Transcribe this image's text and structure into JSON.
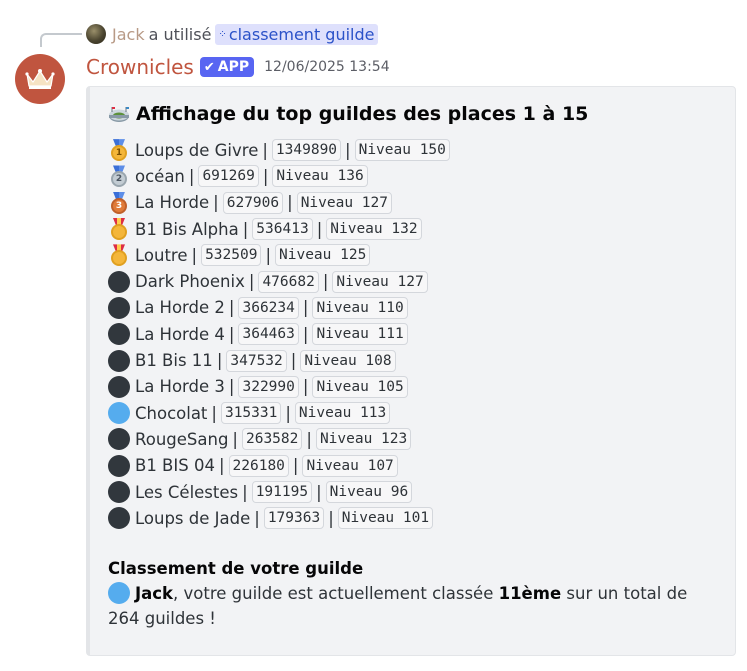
{
  "interaction": {
    "user": "Jack",
    "text": "a utilisé",
    "command_icon": "command-dots-icon",
    "command": "classement guilde"
  },
  "author": {
    "name": "Crownicles",
    "badge": "APP",
    "badge_icon": "check-icon",
    "timestamp": "12/06/2025 13:54",
    "avatar_icon": "crown-icon"
  },
  "embed": {
    "title_icon": "stadium-icon",
    "title": "Affichage du top guildes des places 1 à 15",
    "rows": [
      {
        "icon": "gold-medal",
        "rank": "1",
        "name": "Loups de Givre",
        "score": "1349890",
        "level": "Niveau 150"
      },
      {
        "icon": "silver-medal",
        "rank": "2",
        "name": "océan",
        "score": "691269",
        "level": "Niveau 136"
      },
      {
        "icon": "bronze-medal",
        "rank": "3",
        "name": "La Horde",
        "score": "627906",
        "level": "Niveau 127"
      },
      {
        "icon": "military-medal",
        "rank": "",
        "name": "B1 Bis Alpha",
        "score": "536413",
        "level": "Niveau 132"
      },
      {
        "icon": "military-medal",
        "rank": "",
        "name": "Loutre",
        "score": "532509",
        "level": "Niveau 125"
      },
      {
        "icon": "black-circle",
        "rank": "",
        "name": "Dark Phoenix",
        "score": "476682",
        "level": "Niveau 127"
      },
      {
        "icon": "black-circle",
        "rank": "",
        "name": "La Horde 2",
        "score": "366234",
        "level": "Niveau 110"
      },
      {
        "icon": "black-circle",
        "rank": "",
        "name": "La Horde 4",
        "score": "364463",
        "level": "Niveau 111"
      },
      {
        "icon": "black-circle",
        "rank": "",
        "name": "B1 Bis 11",
        "score": "347532",
        "level": "Niveau 108"
      },
      {
        "icon": "black-circle",
        "rank": "",
        "name": "La Horde 3",
        "score": "322990",
        "level": "Niveau 105"
      },
      {
        "icon": "blue-circle",
        "rank": "",
        "name": "Chocolat",
        "score": "315331",
        "level": "Niveau 113"
      },
      {
        "icon": "black-circle",
        "rank": "",
        "name": "RougeSang",
        "score": "263582",
        "level": "Niveau 123"
      },
      {
        "icon": "black-circle",
        "rank": "",
        "name": "B1 BIS 04",
        "score": "226180",
        "level": "Niveau 107"
      },
      {
        "icon": "black-circle",
        "rank": "",
        "name": "Les Célestes",
        "score": "191195",
        "level": "Niveau 96"
      },
      {
        "icon": "black-circle",
        "rank": "",
        "name": "Loups de Jade",
        "score": "179363",
        "level": "Niveau 101"
      }
    ],
    "separator": "|",
    "section_title": "Classement de votre guilde",
    "summary": {
      "icon": "blue-circle",
      "user": "Jack",
      "text_before": ", votre guilde est actuellement classée ",
      "rank": "11ème",
      "text_after": " sur un total de 264 guildes !"
    }
  },
  "colors": {
    "author": "#c0553f",
    "badge": "#5865f2",
    "command_bg": "#dee0fc",
    "command_text": "#2b52c8",
    "gold": "#f4b63a",
    "silver": "#c3ccd3",
    "bronze": "#e07b39",
    "black_circle": "#31373d",
    "blue_circle": "#55acee"
  }
}
